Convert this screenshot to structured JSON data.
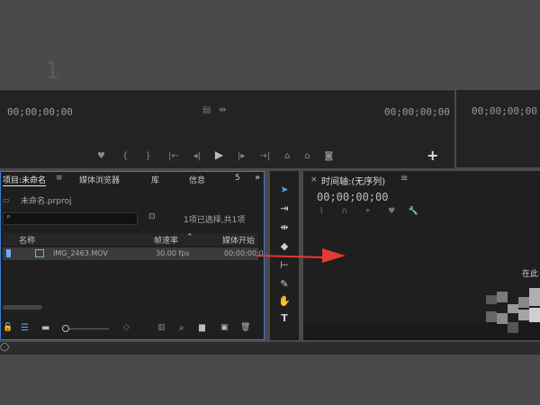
{
  "step_number": "1",
  "source_monitor": {
    "timecode_left": "00;00;00;00",
    "timecode_right": "00;00;00;00"
  },
  "program_monitor": {
    "timecode": "00;00;00;00"
  },
  "project_panel": {
    "tabs": [
      "项目:未命名",
      "媒体浏览器",
      "库",
      "信息",
      "5"
    ],
    "project_file": "未命名.prproj",
    "selection_status": "1项已选择,共1项",
    "columns": [
      "名称",
      "帧速率",
      "媒体开始"
    ],
    "rows": [
      {
        "name": "IMG_2463.MOV",
        "fps": "30.00 fps",
        "start": "00;00;00;0"
      }
    ]
  },
  "timeline": {
    "title": "时间轴:(无序列)",
    "timecode": "00;00;00;00",
    "hint": "在此"
  },
  "colors": {
    "accent": "#3a7bd5",
    "arrow": "#e53935",
    "active_tool": "#4aa3ff"
  }
}
